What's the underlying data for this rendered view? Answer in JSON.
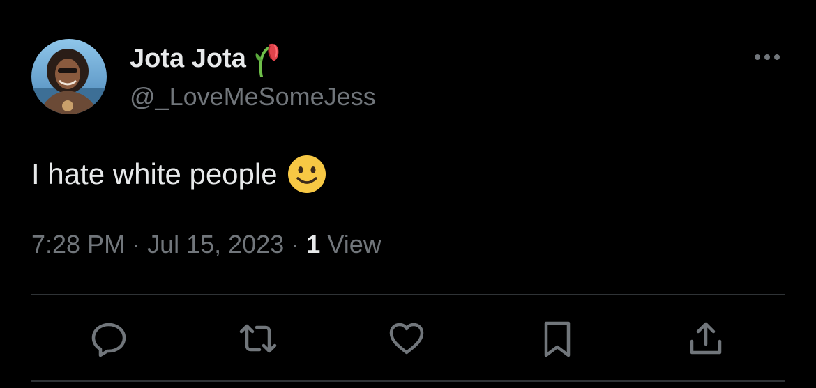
{
  "tweet": {
    "author": {
      "display_name": "Jota Jota",
      "handle": "@_LoveMeSomeJess",
      "name_emoji": "wilted-rose-icon"
    },
    "text": "I hate white people",
    "text_emoji": "slightly-smiling-face-icon",
    "time": "7:28 PM",
    "date": "Jul 15, 2023",
    "separator": "·",
    "views_count": "1",
    "views_label": "View"
  },
  "actions": [
    {
      "name": "reply",
      "icon": "reply-icon"
    },
    {
      "name": "retweet",
      "icon": "retweet-icon"
    },
    {
      "name": "like",
      "icon": "heart-icon"
    },
    {
      "name": "bookmark",
      "icon": "bookmark-icon"
    },
    {
      "name": "share",
      "icon": "share-icon"
    }
  ],
  "colors": {
    "background": "#000000",
    "primary_text": "#e7e9ea",
    "secondary_text": "#71767b",
    "divider": "#2f3336"
  }
}
